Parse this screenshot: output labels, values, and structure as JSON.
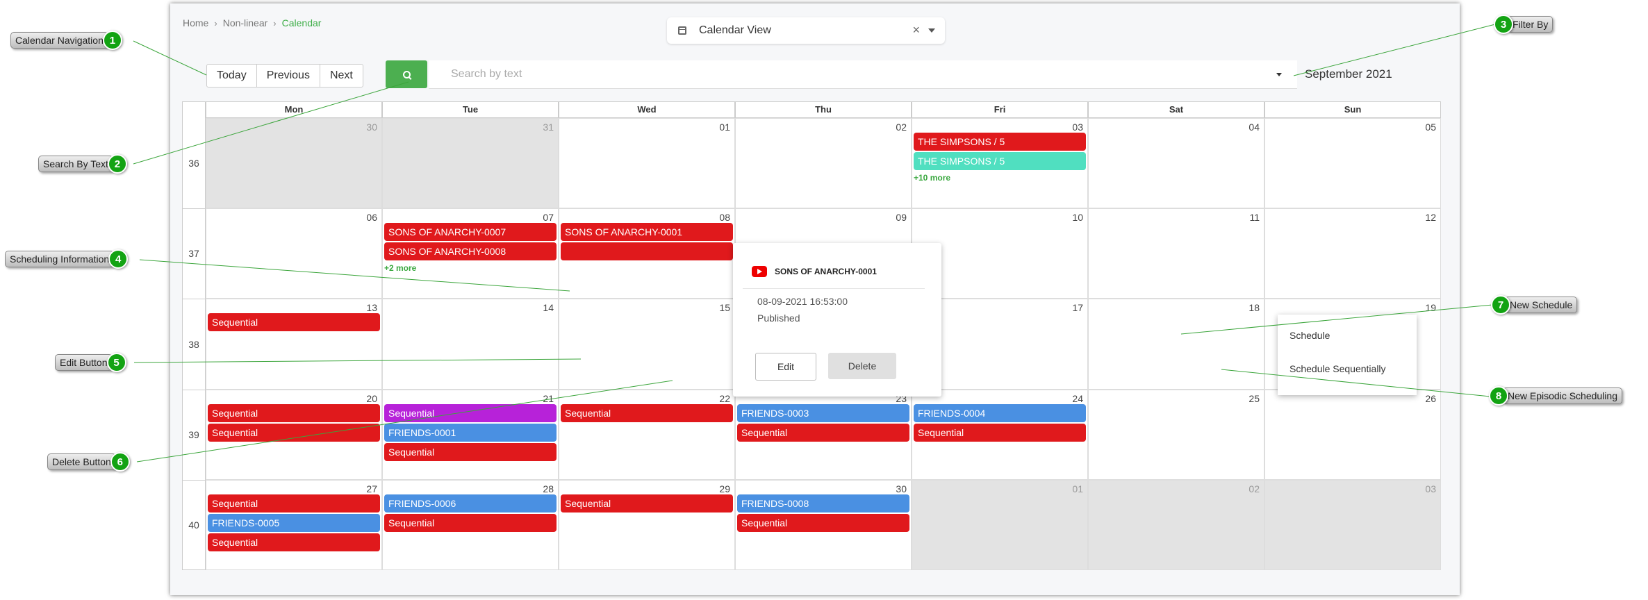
{
  "breadcrumb": {
    "items": [
      "Home",
      "Non-linear"
    ],
    "active": "Calendar"
  },
  "view_selector": {
    "label": "Calendar View",
    "clear": "×"
  },
  "nav": {
    "today": "Today",
    "previous": "Previous",
    "next": "Next"
  },
  "search": {
    "placeholder": "Search by text"
  },
  "month_label": "September 2021",
  "days": [
    "Mon",
    "Tue",
    "Wed",
    "Thu",
    "Fri",
    "Sat",
    "Sun"
  ],
  "weeks": [
    {
      "num": "36",
      "dates": [
        "30",
        "31",
        "01",
        "02",
        "03",
        "04",
        "05"
      ],
      "dim": [
        true,
        true,
        false,
        false,
        false,
        false,
        false
      ]
    },
    {
      "num": "37",
      "dates": [
        "06",
        "07",
        "08",
        "09",
        "10",
        "11",
        "12"
      ],
      "dim": [
        false,
        false,
        false,
        false,
        false,
        false,
        false
      ]
    },
    {
      "num": "38",
      "dates": [
        "13",
        "14",
        "15",
        "16",
        "17",
        "18",
        "19"
      ],
      "dim": [
        false,
        false,
        false,
        false,
        false,
        false,
        false
      ]
    },
    {
      "num": "39",
      "dates": [
        "20",
        "21",
        "22",
        "23",
        "24",
        "25",
        "26"
      ],
      "dim": [
        false,
        false,
        false,
        false,
        false,
        false,
        false
      ]
    },
    {
      "num": "40",
      "dates": [
        "27",
        "28",
        "29",
        "30",
        "01",
        "02",
        "03"
      ],
      "dim": [
        false,
        false,
        false,
        false,
        true,
        true,
        true
      ]
    }
  ],
  "events": [
    {
      "week": 0,
      "day": 4,
      "items": [
        {
          "label": "THE SIMPSONS / 5",
          "color": "#e0191c"
        },
        {
          "label": "THE SIMPSONS / 5",
          "color": "#50dfc0"
        }
      ],
      "more": "+10 more"
    },
    {
      "week": 1,
      "day": 1,
      "items": [
        {
          "label": "SONS OF ANARCHY-0007",
          "color": "#e0191c"
        },
        {
          "label": "SONS OF ANARCHY-0008",
          "color": "#e0191c"
        }
      ],
      "more": "+2 more"
    },
    {
      "week": 1,
      "day": 2,
      "items": [
        {
          "label": "SONS OF ANARCHY-0001",
          "color": "#e0191c"
        },
        {
          "label": "",
          "color": "#e0191c"
        }
      ]
    },
    {
      "week": 2,
      "day": 0,
      "items": [
        {
          "label": "Sequential",
          "color": "#e0191c"
        }
      ]
    },
    {
      "week": 3,
      "day": 0,
      "items": [
        {
          "label": "Sequential",
          "color": "#e0191c"
        },
        {
          "label": "Sequential",
          "color": "#e0191c"
        }
      ]
    },
    {
      "week": 3,
      "day": 1,
      "items": [
        {
          "label": "Sequential",
          "color": "#b722d9"
        },
        {
          "label": "FRIENDS-0001",
          "color": "#4a90e2"
        },
        {
          "label": "Sequential",
          "color": "#e0191c"
        }
      ]
    },
    {
      "week": 3,
      "day": 2,
      "items": [
        {
          "label": "Sequential",
          "color": "#e0191c"
        }
      ]
    },
    {
      "week": 3,
      "day": 3,
      "items": [
        {
          "label": "FRIENDS-0003",
          "color": "#4a90e2"
        },
        {
          "label": "Sequential",
          "color": "#e0191c"
        }
      ]
    },
    {
      "week": 3,
      "day": 4,
      "items": [
        {
          "label": "FRIENDS-0004",
          "color": "#4a90e2"
        },
        {
          "label": "Sequential",
          "color": "#e0191c"
        }
      ]
    },
    {
      "week": 4,
      "day": 0,
      "items": [
        {
          "label": "Sequential",
          "color": "#e0191c"
        },
        {
          "label": "FRIENDS-0005",
          "color": "#4a90e2"
        },
        {
          "label": "Sequential",
          "color": "#e0191c"
        }
      ]
    },
    {
      "week": 4,
      "day": 1,
      "items": [
        {
          "label": "FRIENDS-0006",
          "color": "#4a90e2"
        },
        {
          "label": "Sequential",
          "color": "#e0191c"
        }
      ]
    },
    {
      "week": 4,
      "day": 2,
      "items": [
        {
          "label": "Sequential",
          "color": "#e0191c"
        }
      ]
    },
    {
      "week": 4,
      "day": 3,
      "items": [
        {
          "label": "FRIENDS-0008",
          "color": "#4a90e2"
        },
        {
          "label": "Sequential",
          "color": "#e0191c"
        }
      ]
    }
  ],
  "popup": {
    "title": "SONS OF ANARCHY-0001",
    "datetime": "08-09-2021 16:53:00",
    "status": "Published",
    "edit": "Edit",
    "delete": "Delete"
  },
  "context_menu": {
    "schedule": "Schedule",
    "schedule_sequentially": "Schedule Sequentially"
  },
  "callouts": [
    {
      "num": "1",
      "label": "Calendar Navigation"
    },
    {
      "num": "2",
      "label": "Search By Text"
    },
    {
      "num": "3",
      "label": "Filter By"
    },
    {
      "num": "4",
      "label": "Scheduling Information"
    },
    {
      "num": "5",
      "label": "Edit Button"
    },
    {
      "num": "6",
      "label": "Delete Button"
    },
    {
      "num": "7",
      "label": "New Schedule"
    },
    {
      "num": "8",
      "label": "New Episodic Scheduling"
    }
  ],
  "colors": {
    "accent_green": "#4caf50",
    "event_red": "#e0191c",
    "event_blue": "#4a90e2",
    "event_teal": "#50dfc0",
    "event_purple": "#b722d9",
    "badge_green": "#13a313"
  }
}
